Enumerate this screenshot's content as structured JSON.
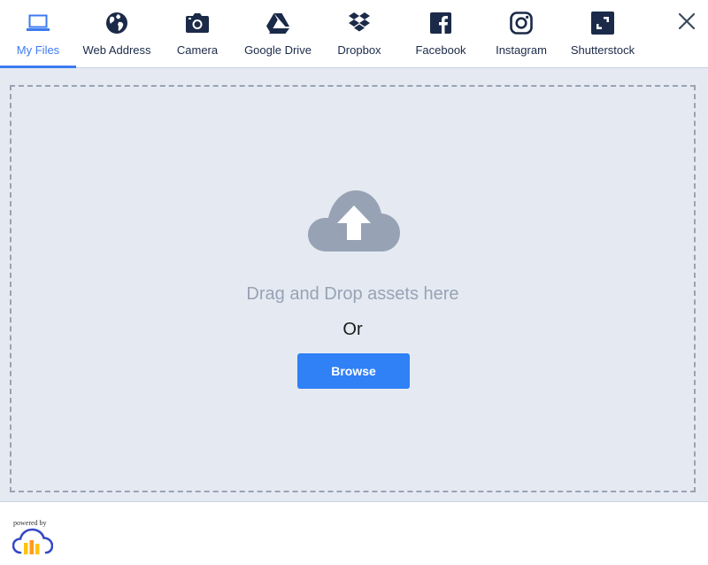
{
  "tabs": [
    {
      "id": "my-files",
      "label": "My Files",
      "icon": "laptop-icon",
      "active": true
    },
    {
      "id": "web-address",
      "label": "Web Address",
      "icon": "globe-icon",
      "active": false
    },
    {
      "id": "camera",
      "label": "Camera",
      "icon": "camera-icon",
      "active": false
    },
    {
      "id": "google-drive",
      "label": "Google Drive",
      "icon": "google-drive-icon",
      "active": false
    },
    {
      "id": "dropbox",
      "label": "Dropbox",
      "icon": "dropbox-icon",
      "active": false
    },
    {
      "id": "facebook",
      "label": "Facebook",
      "icon": "facebook-icon",
      "active": false
    },
    {
      "id": "instagram",
      "label": "Instagram",
      "icon": "instagram-icon",
      "active": false
    },
    {
      "id": "shutterstock",
      "label": "Shutterstock",
      "icon": "shutterstock-icon",
      "active": false
    }
  ],
  "close": {
    "icon": "close-icon"
  },
  "dropzone": {
    "icon": "cloud-upload-icon",
    "drag_text": "Drag and Drop assets here",
    "or_text": "Or",
    "browse_label": "Browse"
  },
  "footer": {
    "powered_by": "powered by",
    "logo": "cloudinary-logo-icon"
  },
  "colors": {
    "accent": "#3d7bf0",
    "button": "#3080f6",
    "icon_dark": "#1b2a48",
    "dropzone_bg": "#e5eaf2",
    "dropzone_border": "#98a3b3",
    "muted_text": "#97a3b4"
  }
}
